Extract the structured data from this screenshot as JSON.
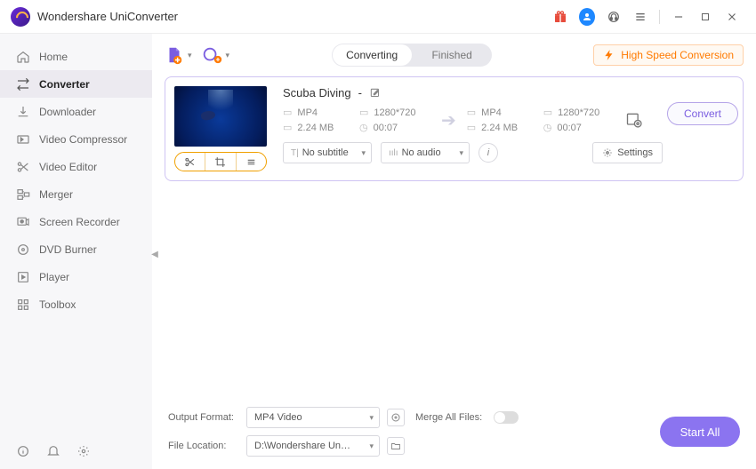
{
  "titlebar": {
    "title": "Wondershare UniConverter"
  },
  "sidebar": {
    "items": [
      {
        "label": "Home"
      },
      {
        "label": "Converter"
      },
      {
        "label": "Downloader"
      },
      {
        "label": "Video Compressor"
      },
      {
        "label": "Video Editor"
      },
      {
        "label": "Merger"
      },
      {
        "label": "Screen Recorder"
      },
      {
        "label": "DVD Burner"
      },
      {
        "label": "Player"
      },
      {
        "label": "Toolbox"
      }
    ]
  },
  "tabs": {
    "converting": "Converting",
    "finished": "Finished"
  },
  "hspeed": "High Speed Conversion",
  "file": {
    "title": "Scuba Diving",
    "dash": " - ",
    "src": {
      "format": "MP4",
      "resolution": "1280*720",
      "size": "2.24 MB",
      "duration": "00:07"
    },
    "dst": {
      "format": "MP4",
      "resolution": "1280*720",
      "size": "2.24 MB",
      "duration": "00:07"
    },
    "subtitle": "No subtitle",
    "audio": "No audio",
    "settings": "Settings",
    "convert": "Convert"
  },
  "footer": {
    "outputFormatLabel": "Output Format:",
    "outputFormat": "MP4 Video",
    "mergeLabel": "Merge All Files:",
    "fileLocationLabel": "File Location:",
    "fileLocation": "D:\\Wondershare UniConverter",
    "startAll": "Start All"
  }
}
